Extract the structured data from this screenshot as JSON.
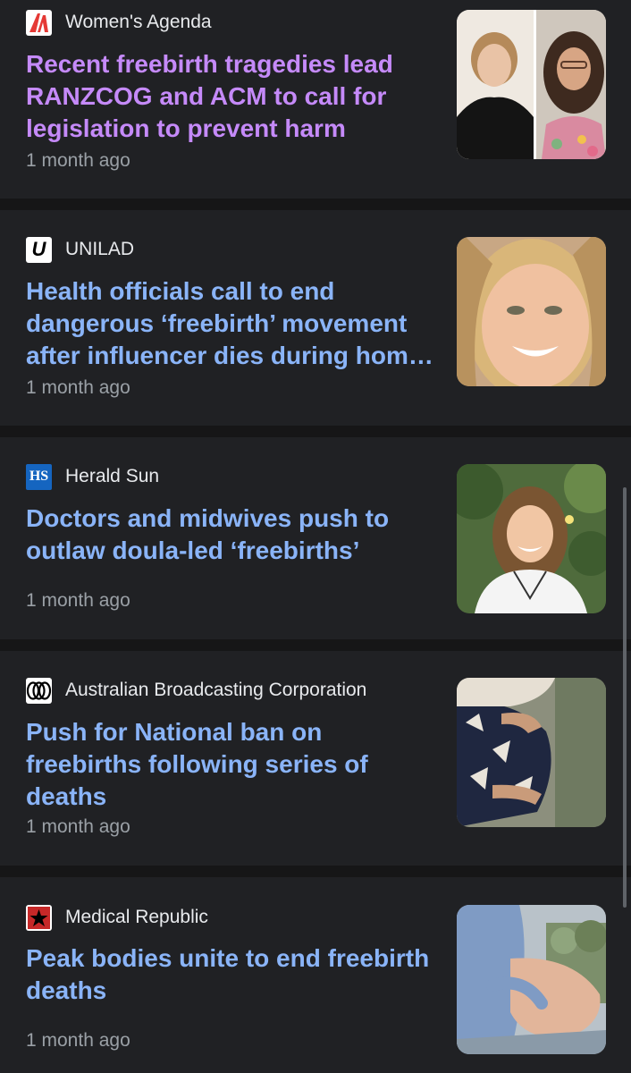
{
  "articles": [
    {
      "source": "Women's Agenda",
      "logo_icon": "womens-agenda-logo",
      "headline": "Recent freebirth tragedies lead RANZCOG and ACM to call for legislation to prevent harm",
      "time": "1 month ago",
      "visited": true
    },
    {
      "source": "UNILAD",
      "logo_icon": "unilad-logo",
      "logo_text": "U",
      "headline": "Health officials call to end dangerous ‘freebirth’ movement after influencer dies during hom…",
      "time": "1 month ago",
      "visited": false
    },
    {
      "source": "Herald Sun",
      "logo_icon": "herald-sun-logo",
      "logo_text": "HS",
      "headline": "Doctors and midwives push to outlaw doula-led ‘freebirths’",
      "time": "1 month ago",
      "visited": false
    },
    {
      "source": "Australian Broadcasting Corporation",
      "logo_icon": "abc-logo",
      "headline": "Push for National ban on freebirths following series of deaths",
      "time": "1 month ago",
      "visited": false
    },
    {
      "source": "Medical Republic",
      "logo_icon": "medical-republic-logo",
      "headline": "Peak bodies unite to end freebirth deaths",
      "time": "1 month ago",
      "visited": false
    }
  ],
  "colors": {
    "background": "#202124",
    "link": "#8ab4f8",
    "visited_link": "#c58af9",
    "source_text": "#e8eaed",
    "meta_text": "#9aa0a6"
  }
}
